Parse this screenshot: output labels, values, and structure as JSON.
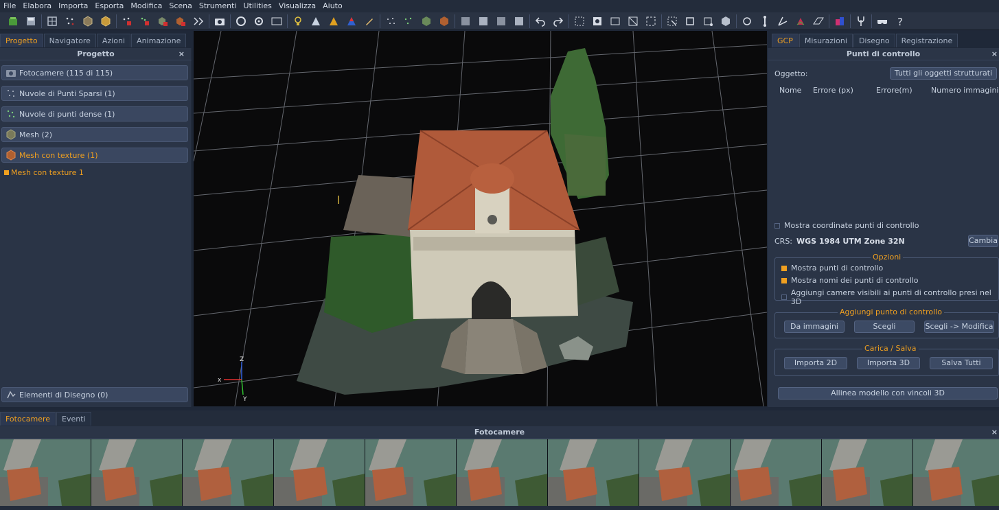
{
  "menu": [
    "File",
    "Elabora",
    "Importa",
    "Esporta",
    "Modifica",
    "Scena",
    "Strumenti",
    "Utilities",
    "Visualizza",
    "Aiuto"
  ],
  "left_panel": {
    "tabs": [
      "Progetto",
      "Navigatore",
      "Azioni",
      "Animazione"
    ],
    "title": "Progetto",
    "close": "×",
    "categories": [
      {
        "label": "Fotocamere (115 di 115)",
        "icon": "camera-icon"
      },
      {
        "label": "Nuvole di Punti Sparsi (1)",
        "icon": "sparse-cloud-icon"
      },
      {
        "label": "Nuvole di punti dense (1)",
        "icon": "dense-cloud-icon"
      },
      {
        "label": "Mesh (2)",
        "icon": "mesh-icon"
      },
      {
        "label": "Mesh con texture (1)",
        "icon": "textured-mesh-icon"
      }
    ],
    "mesh_item": "Mesh con texture 1",
    "drawing_elements": "Elementi di Disegno (0)"
  },
  "viewport": {
    "axes": {
      "x": "x",
      "y": "Y",
      "z": "Z"
    }
  },
  "right_panel": {
    "tabs": [
      "GCP",
      "Misurazioni",
      "Disegno",
      "Registrazione"
    ],
    "title": "Punti di controllo",
    "close": "×",
    "object_label": "Oggetto:",
    "object_value": "Tutti gli oggetti strutturati",
    "columns": [
      "Nome",
      "Errore (px)",
      "Errore(m)",
      "Numero immagini"
    ],
    "show_coords": "Mostra coordinate punti di controllo",
    "crs_label": "CRS:",
    "crs_value": "WGS 1984 UTM Zone 32N",
    "change_button": "Cambia",
    "options_title": "Opzioni",
    "options": [
      {
        "label": "Mostra punti di controllo",
        "checked": true
      },
      {
        "label": "Mostra nomi dei punti di controllo",
        "checked": true
      },
      {
        "label": "Aggiungi camere visibili ai punti di controllo presi nel 3D",
        "checked": false
      }
    ],
    "add_title": "Aggiungi punto di controllo",
    "add_buttons": [
      "Da immagini",
      "Scegli",
      "Scegli -> Modifica"
    ],
    "load_title": "Carica / Salva",
    "load_buttons": [
      "Importa 2D",
      "Importa 3D",
      "Salva Tutti"
    ],
    "align_button": "Allinea modello con vincoli 3D"
  },
  "bottom_panel": {
    "tabs": [
      "Fotocamere",
      "Eventi"
    ],
    "title": "Fotocamere",
    "close": "×"
  },
  "colors": {
    "accent": "#f0a020",
    "panel": "#2a3446",
    "background": "#1f2838"
  }
}
